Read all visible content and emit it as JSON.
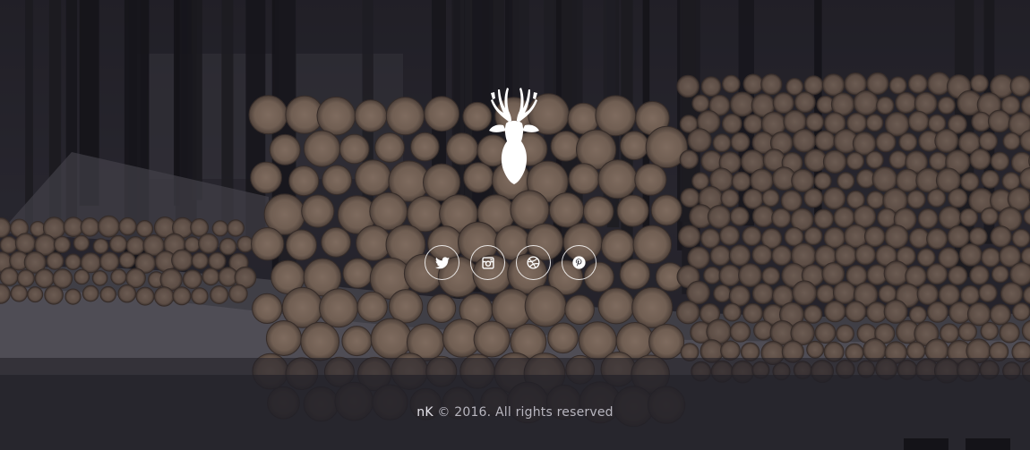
{
  "social": [
    {
      "name": "twitter",
      "icon": "twitter-icon"
    },
    {
      "name": "instagram",
      "icon": "instagram-icon"
    },
    {
      "name": "dribbble",
      "icon": "dribbble-icon"
    },
    {
      "name": "pinterest",
      "icon": "pinterest-icon"
    }
  ],
  "footer": {
    "brand": "nK",
    "copyright": "© 2016. All rights reserved"
  },
  "colors": {
    "accent": "#ffffff",
    "footer_text": "#b8b6bf"
  },
  "logo": {
    "icon": "deer-head-icon"
  }
}
